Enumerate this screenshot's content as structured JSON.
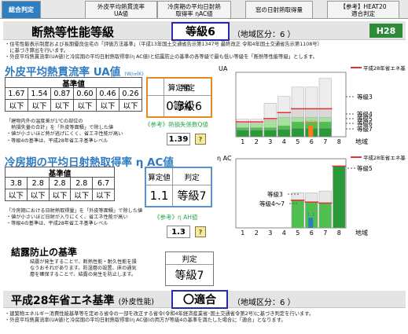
{
  "tabs": [
    {
      "label": "総合判定",
      "active": true
    },
    {
      "label": "外皮平均熱貫流率\nUA値",
      "active": false
    },
    {
      "label": "冷房期の平均日射熱\n取得率 ηAC値",
      "active": false
    },
    {
      "label": "窓の日射熱取得量",
      "active": false
    },
    {
      "label": "【参考】HEAT20\n適合判定",
      "active": false
    }
  ],
  "insulation": {
    "title": "断熱等性能等級",
    "grade": "等級6",
    "region": "（地域区分：6 ）",
    "badge": "H28",
    "notes": [
      "・住宅性能表示制度および長期優良住宅の「評価方法基準」（平成13年国土交通省告示第1347号 最終改正 令和4年国土交通省告示第1108号）",
      "　に基づき算出を行います。",
      "・外皮平均熱貫流率(UA値)と冷房期の平均日射熱取得率(η AC値)と結露防止の基準の各等級で最も低い等級を「断熱等性能等級」とします。"
    ]
  },
  "ua": {
    "title": "外皮平均熱貫流率 UA値",
    "unit": "(W/㎡K)",
    "kijun_label": "基準値",
    "thresholds": [
      "1.67",
      "1.54",
      "0.87",
      "0.60",
      "0.46",
      "0.26"
    ],
    "ika": "以下",
    "calc_label": "算定値",
    "judge_label": "判定",
    "calc_value": "0.34",
    "judge_value": "等級6",
    "notes": [
      "「建物内外の温度差が1℃の部位の",
      "　熱損失量の合計」を「外皮等面積」で除した値",
      "・値が小さいほど熱が逃げにくく、省エネ性能が高い",
      "・等級4の基準は、平成28年省エネ基準レベル"
    ],
    "ref_label": "《参考》熱損失係数Q値",
    "ref_value": "1.39",
    "help": "?"
  },
  "ua_chart": {
    "axis_label": "UA",
    "legend": "平成28年省エネ基準",
    "labels": [
      "等級3",
      "等級4",
      "等級5",
      "等級6",
      "等級7"
    ],
    "x_title": "地域",
    "value_marker": "0.34"
  },
  "eta": {
    "title": "冷房期の平均日射熱取得率 η AC値",
    "kijun_label": "基準値",
    "thresholds": [
      "3.8",
      "2.8",
      "2.8",
      "2.8",
      "6.7"
    ],
    "ika": "以下",
    "calc_label": "算定値",
    "judge_label": "判定",
    "calc_value": "1.1",
    "judge_value": "等級7",
    "notes": [
      "「冷房期における日射熱取得量」を「外皮等面積」で除した値",
      "・値が小さいほど日射が入りにくく、省エネ性能が高い",
      "・等級4の基準は、平成28年省エネ基準レベル"
    ],
    "ref_label": "《参考》η AH値",
    "ref_value": "1.3",
    "help": "?"
  },
  "eta_chart": {
    "axis_label": "η AC",
    "legend": "平成28年省エネ基準",
    "labels": [
      "等級5",
      "等級3",
      "等級4～7"
    ],
    "x_title": "地域",
    "value_marker": "1.1"
  },
  "chart_data": [
    {
      "type": "bar",
      "title": "",
      "xlabel": "地域",
      "ylabel": "UA",
      "categories": [
        "1",
        "2",
        "3",
        "4",
        "5",
        "6",
        "7",
        "8"
      ],
      "series": [
        {
          "name": "等級3",
          "values": [
            0.54,
            0.54,
            1.04,
            1.25,
            1.54,
            1.54,
            1.81,
            null
          ]
        },
        {
          "name": "等級4",
          "values": [
            0.46,
            0.46,
            0.56,
            0.75,
            0.87,
            0.87,
            0.87,
            null
          ]
        },
        {
          "name": "等級5",
          "values": [
            0.4,
            0.4,
            0.5,
            0.6,
            0.6,
            0.6,
            0.6,
            null
          ]
        },
        {
          "name": "等級6",
          "values": [
            0.28,
            0.28,
            0.28,
            0.34,
            0.46,
            0.46,
            0.46,
            null
          ]
        },
        {
          "name": "等級7",
          "values": [
            0.2,
            0.2,
            0.2,
            0.23,
            0.26,
            0.26,
            0.26,
            null
          ]
        }
      ],
      "markers": [
        {
          "category": "6",
          "value": 0.34
        }
      ]
    },
    {
      "type": "bar",
      "title": "",
      "xlabel": "地域",
      "ylabel": "η AC",
      "categories": [
        "1",
        "2",
        "3",
        "4",
        "5",
        "6",
        "7",
        "8"
      ],
      "series": [
        {
          "name": "等級5",
          "values": [
            null,
            null,
            null,
            null,
            3.0,
            2.8,
            2.7,
            6.7
          ]
        },
        {
          "name": "等級3",
          "values": [
            null,
            null,
            null,
            null,
            3.8,
            3.8,
            4.0,
            null
          ]
        },
        {
          "name": "等級4～7",
          "values": [
            null,
            null,
            null,
            null,
            3.0,
            2.8,
            2.7,
            6.7
          ]
        }
      ],
      "markers": [
        {
          "category": "6",
          "value": 1.1
        }
      ]
    }
  ],
  "condensation": {
    "title": "結露防止の基準",
    "notes": [
      "結露が発生することで、断熱性能・耐久性能を損",
      "なうおそれがあります。防湿層の設置、床の通気",
      "層を確保することで、結露の発生を防止します。"
    ],
    "judge_label": "判定",
    "judge_value": "等級7"
  },
  "h28": {
    "title": "平成28年省エネ基準",
    "subtitle": "(外皮性能)",
    "result": "〇適合",
    "region": "（地域区分：6 ）",
    "notes": [
      "・建築物エネルギー消費性能基準等を定める省令の一部を改正する省令(令和4年経済産業省･国土交通省令第2号)に基づき判定を行います。",
      "・外皮平均熱貫流率(UA値)と冷房期の平均日射熱取得率(η AC値)の両方が等級4の基準を満たした場合に「適合」となります。"
    ]
  }
}
